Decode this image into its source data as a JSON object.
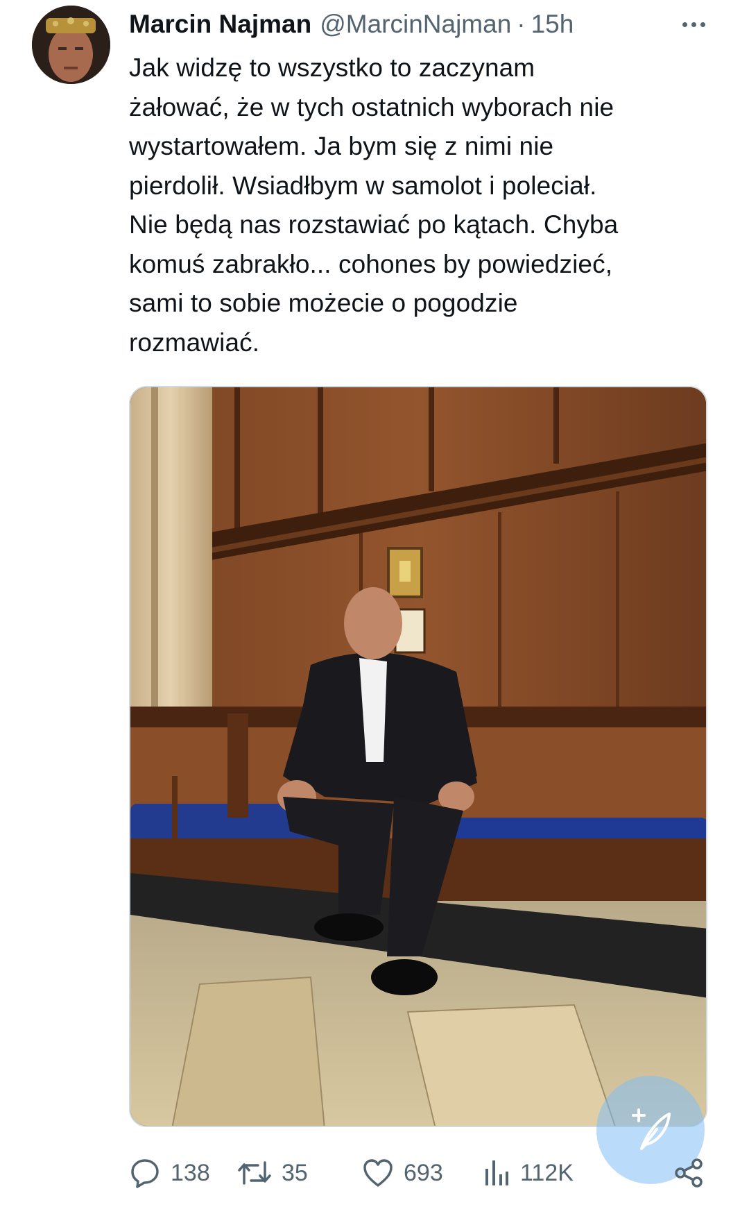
{
  "tweet": {
    "author_name": "Marcin Najman",
    "author_handle": "@MarcinNajman",
    "separator": "·",
    "time": "15h",
    "text": "Jak widzę to wszystko to zaczynam żałować, że w tych ostatnich wyborach nie wystartowałem. Ja bym się z nimi nie pierdolił. Wsiadłbym w samolot i poleciał. Nie będą nas rozstawiać po kątach. Chyba komuś zabrakło... cohones by powiedzieć, sami to sobie możecie o pogodzie rozmawiać.",
    "text_lines": [
      "Jak widzę to wszystko to zaczynam",
      "żałować, że w tych ostatnich wyborach nie",
      "wystartowałem. Ja bym się z nimi nie",
      "pierdolił. Wsiadłbym w samolot i poleciał.",
      "Nie będą nas rozstawiać po kątach. Chyba",
      "komuś zabrakło... cohones by powiedzieć,",
      "sami to sobie możecie o pogodzie",
      "rozmawiać."
    ]
  },
  "actions": {
    "replies": "138",
    "reposts": "35",
    "likes": "693",
    "views": "112K"
  },
  "icons": {
    "more": "more-horizontal-icon",
    "reply": "reply-icon",
    "repost": "repost-icon",
    "like": "heart-icon",
    "views": "views-icon",
    "share": "share-icon",
    "compose": "compose-icon"
  },
  "colors": {
    "text_primary": "#0f1419",
    "text_secondary": "#536471",
    "compose_fab": "#1d9bf0"
  }
}
